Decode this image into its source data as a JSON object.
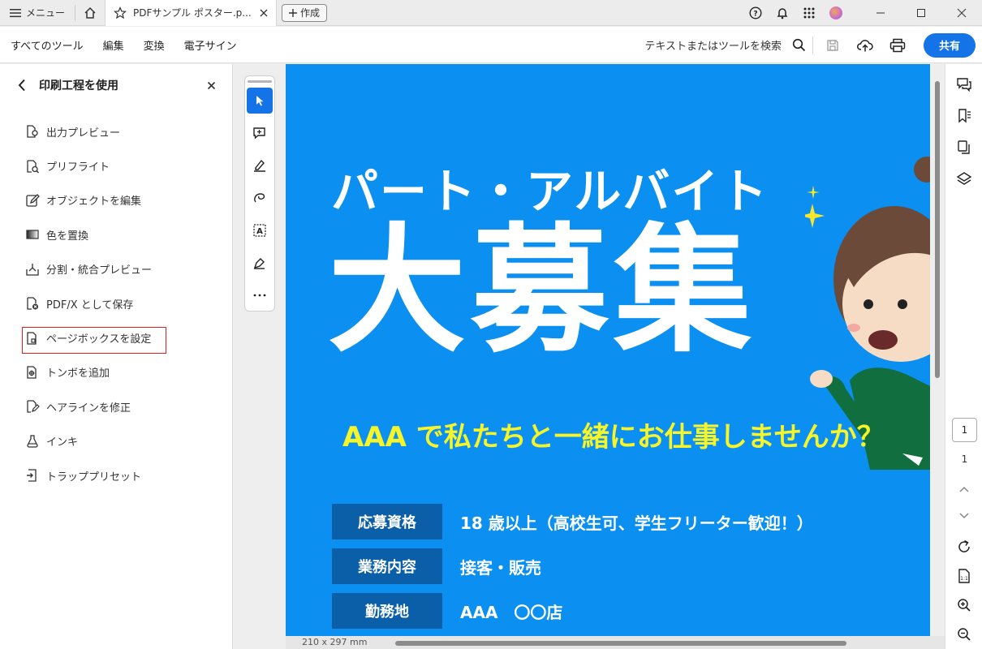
{
  "titlebar": {
    "menu_label": "メニュー",
    "tab_title": "PDFサンプル ポスター.p...",
    "create_label": "作成",
    "window_controls": [
      "minimize-icon",
      "maximize-icon",
      "close-icon"
    ]
  },
  "toolbar": {
    "all_tools": "すべてのツール",
    "edit": "編集",
    "convert": "変換",
    "esign": "電子サイン",
    "search_label": "テキストまたはツールを検索",
    "share_label": "共有"
  },
  "left_panel": {
    "title": "印刷工程を使用",
    "items": [
      {
        "label": "出力プレビュー",
        "icon": "output-preview-icon"
      },
      {
        "label": "プリフライト",
        "icon": "preflight-icon"
      },
      {
        "label": "オブジェクトを編集",
        "icon": "edit-object-icon"
      },
      {
        "label": "色を置換",
        "icon": "replace-color-icon"
      },
      {
        "label": "分割・統合プレビュー",
        "icon": "flattener-preview-icon"
      },
      {
        "label": "PDF/X として保存",
        "icon": "save-pdfx-icon"
      },
      {
        "label": "ページボックスを設定",
        "icon": "page-box-icon"
      },
      {
        "label": "トンボを追加",
        "icon": "add-printer-marks-icon"
      },
      {
        "label": "ヘアラインを修正",
        "icon": "fix-hairlines-icon"
      },
      {
        "label": "インキ",
        "icon": "ink-icon"
      },
      {
        "label": "トラッププリセット",
        "icon": "trap-presets-icon"
      }
    ],
    "highlighted_item": "ページボックスを設定"
  },
  "document": {
    "heading_small": "パート・アルバイト",
    "heading_large": "大募集",
    "subheading": "AAA で私たちと一緒にお仕事しませんか？",
    "rows": [
      {
        "label": "応募資格",
        "value": "18 歳以上（高校生可、学生フリーター歓迎！）"
      },
      {
        "label": "業務内容",
        "value": "接客・販売"
      },
      {
        "label": "勤務地",
        "value": "AAA　〇〇店"
      }
    ],
    "colors": {
      "background": "#0b8ff0",
      "label_bg": "#0a5fa8",
      "subheading": "#f6f52a"
    }
  },
  "status": {
    "page_size": "210 x 297 mm"
  },
  "right_rail": {
    "current_page": "1",
    "total_pages": "1"
  }
}
